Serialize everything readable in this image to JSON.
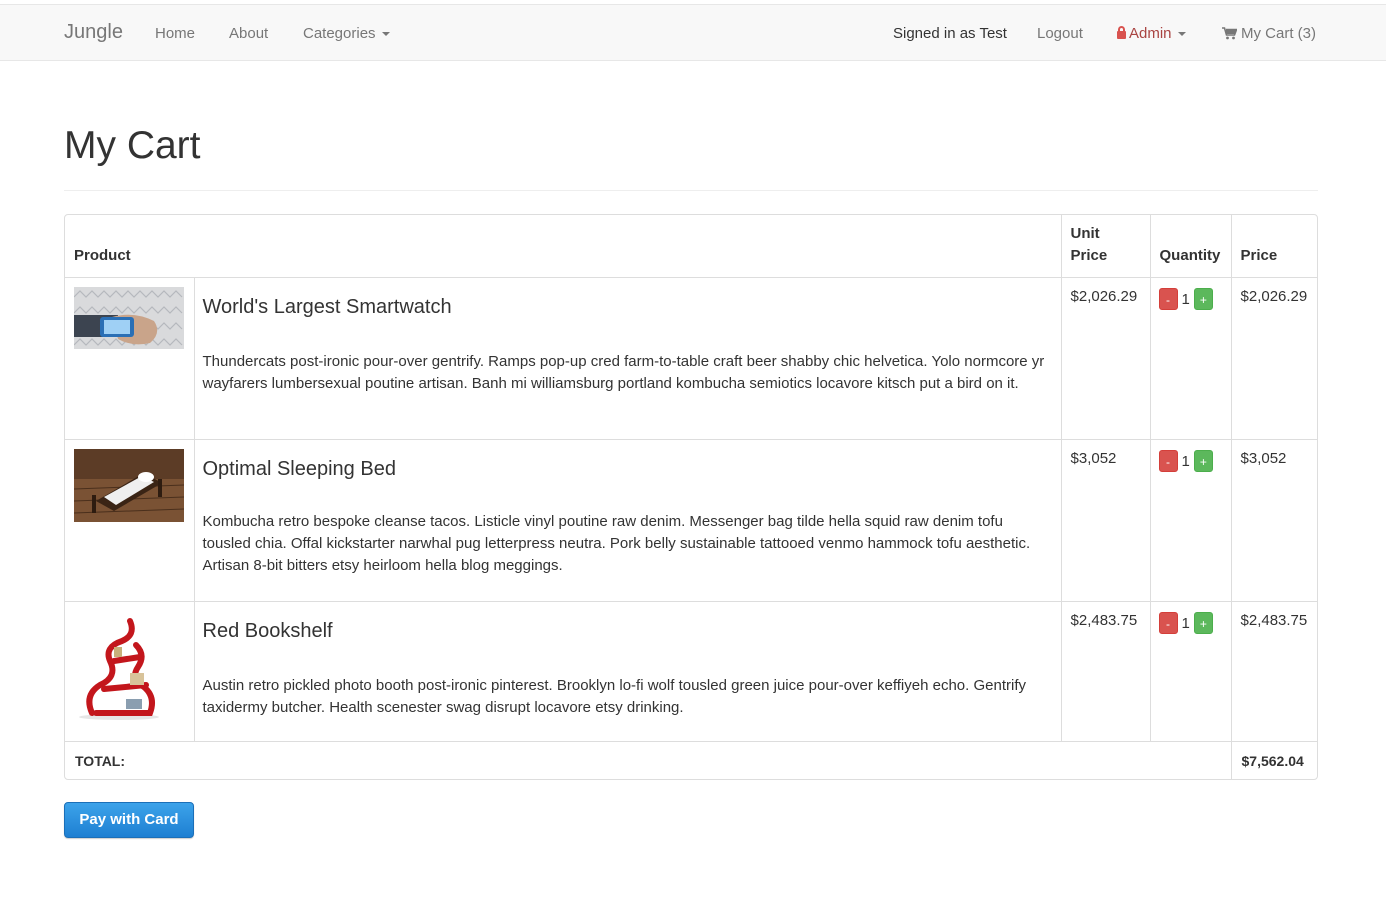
{
  "navbar": {
    "brand": "Jungle",
    "home": "Home",
    "about": "About",
    "categories": "Categories",
    "signed_in": "Signed in as Test",
    "logout": "Logout",
    "admin": "Admin",
    "cart": "My Cart (3)"
  },
  "page": {
    "title": "My Cart"
  },
  "table": {
    "headers": {
      "product": "Product",
      "unit_price": "Unit Price",
      "quantity": "Quantity",
      "price": "Price"
    },
    "rows": [
      {
        "name": "World's Largest Smartwatch",
        "description": "Thundercats post-ironic pour-over gentrify. Ramps pop-up cred farm-to-table craft beer shabby chic helvetica. Yolo normcore yr wayfarers lumbersexual poutine artisan. Banh mi williamsburg portland kombucha semiotics locavore kitsch put a bird on it.",
        "unit_price": "$2,026.29",
        "quantity": "1",
        "price": "$2,026.29"
      },
      {
        "name": "Optimal Sleeping Bed",
        "description": "Kombucha retro bespoke cleanse tacos. Listicle vinyl poutine raw denim. Messenger bag tilde hella squid raw denim tofu tousled chia. Offal kickstarter narwhal pug letterpress neutra. Pork belly sustainable tattooed venmo hammock tofu aesthetic. Artisan 8-bit bitters etsy heirloom hella blog meggings.",
        "unit_price": "$3,052",
        "quantity": "1",
        "price": "$3,052"
      },
      {
        "name": "Red Bookshelf",
        "description": "Austin retro pickled photo booth post-ironic pinterest. Brooklyn lo-fi wolf tousled green juice pour-over keffiyeh echo. Gentrify taxidermy butcher. Health scenester swag disrupt locavore etsy drinking.",
        "unit_price": "$2,483.75",
        "quantity": "1",
        "price": "$2,483.75"
      }
    ],
    "minus_label": "-",
    "plus_label": "+",
    "total_label": "TOTAL:",
    "total_value": "$7,562.04"
  },
  "pay_button": "Pay with Card",
  "colors": {
    "minus": "#d9534f",
    "plus": "#5cb85c",
    "pay": "#1e7fd2",
    "admin": "#a94442"
  },
  "icons": [
    "lock-icon",
    "cart-icon",
    "caret-down-icon"
  ]
}
